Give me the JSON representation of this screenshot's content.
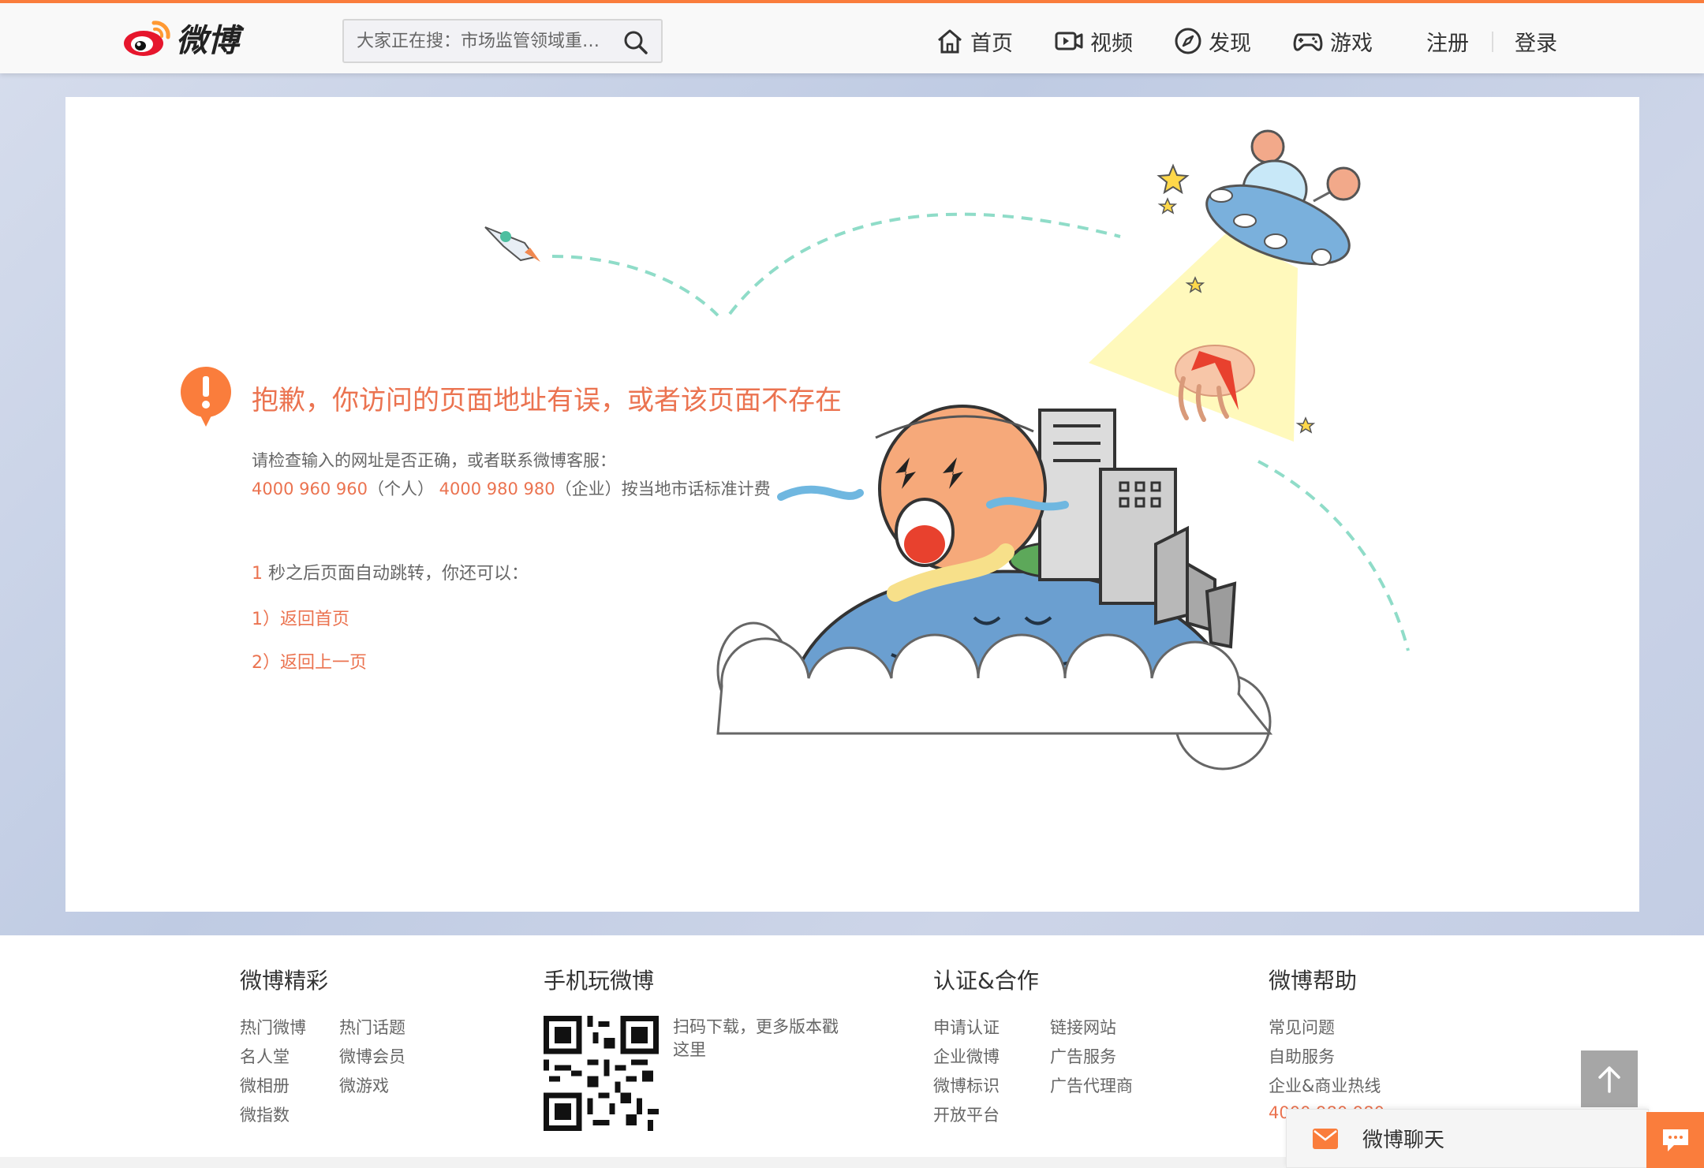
{
  "header": {
    "logo_text": "微博",
    "search_placeholder": "大家正在搜：市场监管领域重…",
    "nav": [
      {
        "label": "首页",
        "icon": "home-icon"
      },
      {
        "label": "视频",
        "icon": "video-icon"
      },
      {
        "label": "发现",
        "icon": "compass-icon"
      },
      {
        "label": "游戏",
        "icon": "gamepad-icon"
      }
    ],
    "register_label": "注册",
    "login_label": "登录"
  },
  "error": {
    "title": "抱歉，你访问的页面地址有误，或者该页面不存在",
    "desc_line1": "请检查输入的网址是否正确，或者联系微博客服：",
    "phone_personal": "4000 960 960",
    "personal_label": "（个人）",
    "phone_enterprise": "4000 980 980",
    "enterprise_label": "（企业）按当地市话标准计费",
    "countdown_num": "1",
    "countdown_text": " 秒之后页面自动跳转，你还可以：",
    "link_home": "1）返回首页",
    "link_back": "2）返回上一页"
  },
  "footer": {
    "col1": {
      "title": "微博精彩",
      "links": [
        "热门微博",
        "热门话题",
        "名人堂",
        "微博会员",
        "微相册",
        "微游戏",
        "微指数"
      ]
    },
    "col2": {
      "title": "手机玩微博",
      "qr_text": "扫码下载，更多版本戳这里"
    },
    "col3": {
      "title": "认证&合作",
      "links": [
        "申请认证",
        "链接网站",
        "企业微博",
        "广告服务",
        "微博标识",
        "广告代理商",
        "开放平台"
      ]
    },
    "col4": {
      "title": "微博帮助",
      "links": [
        "常见问题",
        "自助服务",
        "企业&商业热线"
      ],
      "hotline": "4000 980 980"
    }
  },
  "chat": {
    "label": "微博聊天"
  },
  "colors": {
    "accent": "#fa7d3c",
    "error_text": "#eb7350"
  }
}
